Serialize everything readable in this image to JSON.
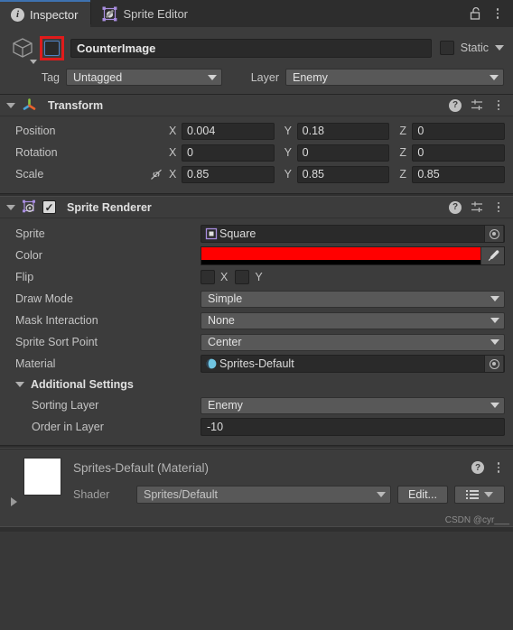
{
  "tabs": [
    {
      "label": "Inspector",
      "icon": "info-icon",
      "active": true
    },
    {
      "label": "Sprite Editor",
      "icon": "sprite-editor-icon",
      "active": false
    }
  ],
  "window_controls": {
    "lock": "lock-open-icon",
    "menu": "kebab-menu-icon"
  },
  "gameobject": {
    "icon": "cube-icon",
    "active_checkbox": true,
    "name": "CounterImage",
    "static_label": "Static",
    "static_checked": false,
    "tag_label": "Tag",
    "tag_value": "Untagged",
    "layer_label": "Layer",
    "layer_value": "Enemy"
  },
  "transform": {
    "title": "Transform",
    "icon": "transform-gizmo-icon",
    "rows": [
      {
        "label": "Position",
        "x": "0.004",
        "y": "0.18",
        "z": "0"
      },
      {
        "label": "Rotation",
        "x": "0",
        "y": "0",
        "z": "0"
      },
      {
        "label": "Scale",
        "x": "0.85",
        "y": "0.85",
        "z": "0.85",
        "link_icon": "broken-link-icon"
      }
    ],
    "axes": {
      "x": "X",
      "y": "Y",
      "z": "Z"
    },
    "header_icons": {
      "help": "?",
      "preset": "preset-icon",
      "menu": "kebab-menu-icon"
    }
  },
  "sprite_renderer": {
    "title": "Sprite Renderer",
    "icon": "sprite-renderer-icon",
    "enabled": true,
    "properties": {
      "sprite_label": "Sprite",
      "sprite_value": "Square",
      "color_label": "Color",
      "color_value": "#FF0000",
      "color_alpha_percent": 70,
      "flip_label": "Flip",
      "flip_x_label": "X",
      "flip_y_label": "Y",
      "flip_x": false,
      "flip_y": false,
      "draw_mode_label": "Draw Mode",
      "draw_mode_value": "Simple",
      "mask_interaction_label": "Mask Interaction",
      "mask_interaction_value": "None",
      "sprite_sort_point_label": "Sprite Sort Point",
      "sprite_sort_point_value": "Center",
      "material_label": "Material",
      "material_value": "Sprites-Default"
    },
    "additional_settings": {
      "title": "Additional Settings",
      "sorting_layer_label": "Sorting Layer",
      "sorting_layer_value": "Enemy",
      "order_in_layer_label": "Order in Layer",
      "order_in_layer_value": "-10"
    }
  },
  "material_preview": {
    "title": "Sprites-Default (Material)",
    "shader_label": "Shader",
    "shader_value": "Sprites/Default",
    "edit_button": "Edit...",
    "preset_button": "preset-list-icon"
  },
  "watermark": "CSDN @cyr___"
}
